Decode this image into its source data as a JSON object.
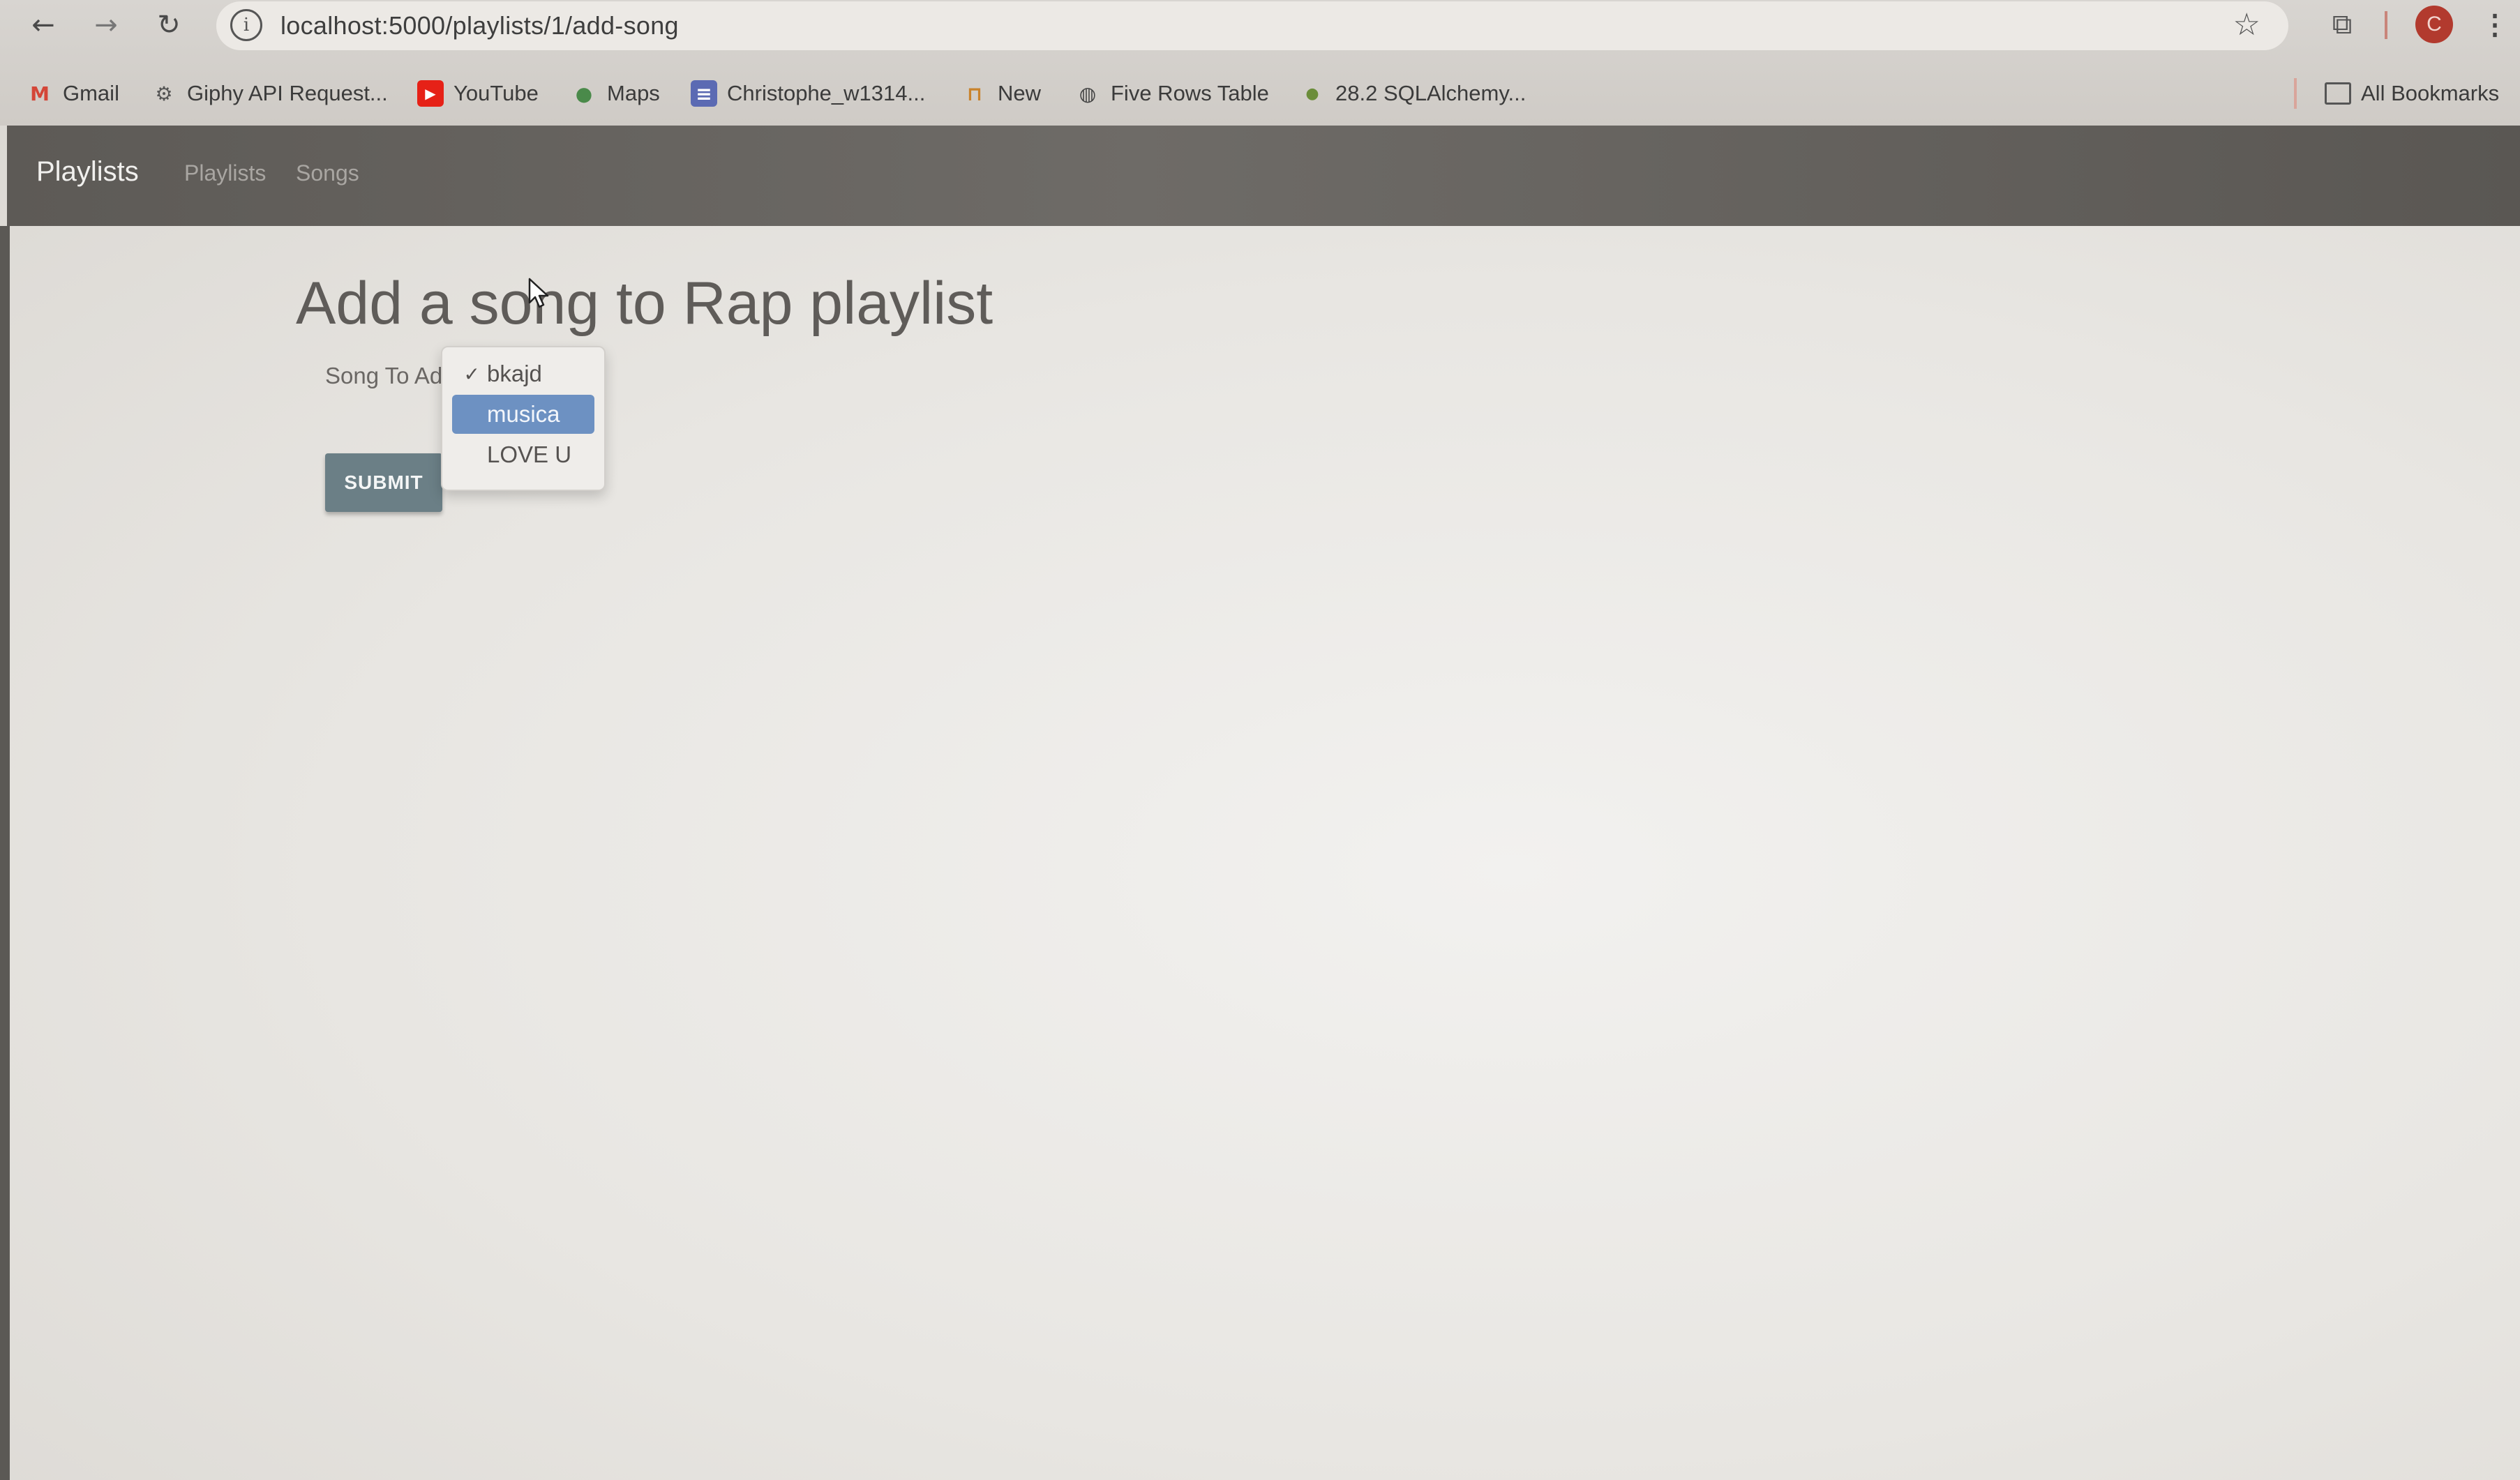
{
  "browser": {
    "url": "localhost:5000/playlists/1/add-song",
    "site_info_glyph": "i",
    "star_glyph": "☆",
    "profile_initial": "C",
    "menu_glyph": "⋮",
    "bookmarks": [
      {
        "label": "Gmail",
        "icon": "gmail-icon",
        "glyph": "M",
        "color": "#d44638"
      },
      {
        "label": "Giphy API Request...",
        "icon": "gear-icon",
        "glyph": "⚙",
        "color": "#555555"
      },
      {
        "label": "YouTube",
        "icon": "youtube-icon",
        "glyph": "▶",
        "color": "#e62117"
      },
      {
        "label": "Maps",
        "icon": "map-pin-icon",
        "glyph": "●",
        "color": "#4a8a4a"
      },
      {
        "label": "Christophe_w1314...",
        "icon": "doc-icon",
        "glyph": "≡",
        "color": "#5b6ab3"
      },
      {
        "label": "New",
        "icon": "jupyter-icon",
        "glyph": "⊓",
        "color": "#c9832c"
      },
      {
        "label": "Five Rows Table",
        "icon": "globe-icon",
        "glyph": "◍",
        "color": "#444444"
      },
      {
        "label": "28.2 SQLAlchemy...",
        "icon": "person-icon",
        "glyph": "●",
        "color": "#6b8d3a"
      }
    ],
    "all_bookmarks": "All Bookmarks"
  },
  "app": {
    "brand": "Playlists",
    "nav": [
      "Playlists",
      "Songs"
    ]
  },
  "main": {
    "title": "Add a song to Rap playlist",
    "field_label": "Song To Ad",
    "submit_label": "SUBMIT",
    "select_options": [
      {
        "label": "bkajd",
        "selected": true,
        "highlighted": false
      },
      {
        "label": "musica",
        "selected": false,
        "highlighted": true
      },
      {
        "label": "LOVE U",
        "selected": false,
        "highlighted": false
      }
    ]
  },
  "colors": {
    "navbar": "#66635f",
    "submit": "#6b7f86",
    "highlight": "#6d91c2"
  }
}
